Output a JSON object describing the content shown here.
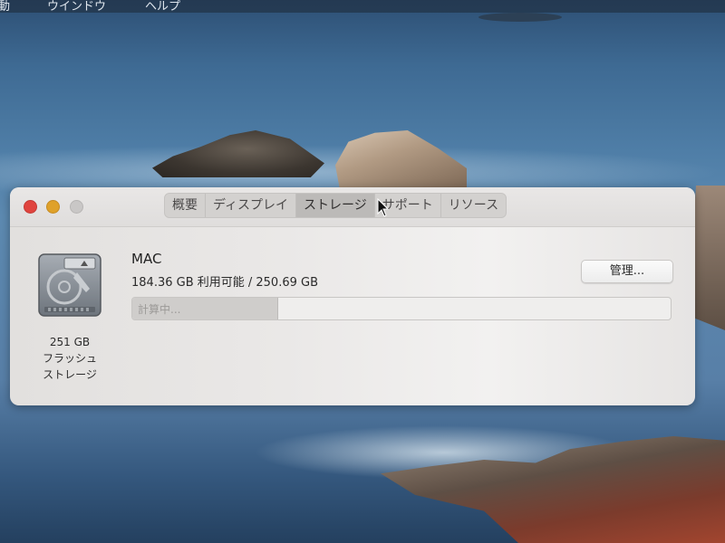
{
  "menubar": {
    "item1": "動",
    "item2": "ウインドウ",
    "item3": "ヘルプ"
  },
  "window": {
    "tabs": [
      {
        "label": "概要"
      },
      {
        "label": "ディスプレイ"
      },
      {
        "label": "ストレージ",
        "active": true
      },
      {
        "label": "サポート"
      },
      {
        "label": "リソース"
      }
    ],
    "disk": {
      "icon": "hard-drive-icon",
      "capacity": "251 GB",
      "type_line1": "フラッシュ",
      "type_line2": "ストレージ"
    },
    "volume": {
      "name": "MAC",
      "availability": "184.36 GB 利用可能 / 250.69 GB"
    },
    "manage_button": "管理...",
    "usage_bar": {
      "label": "計算中...",
      "fill_fraction": 0.27
    }
  },
  "colors": {
    "close": "#e0443e",
    "minimize": "#dfa12a",
    "maximize": "#c9c7c6"
  }
}
